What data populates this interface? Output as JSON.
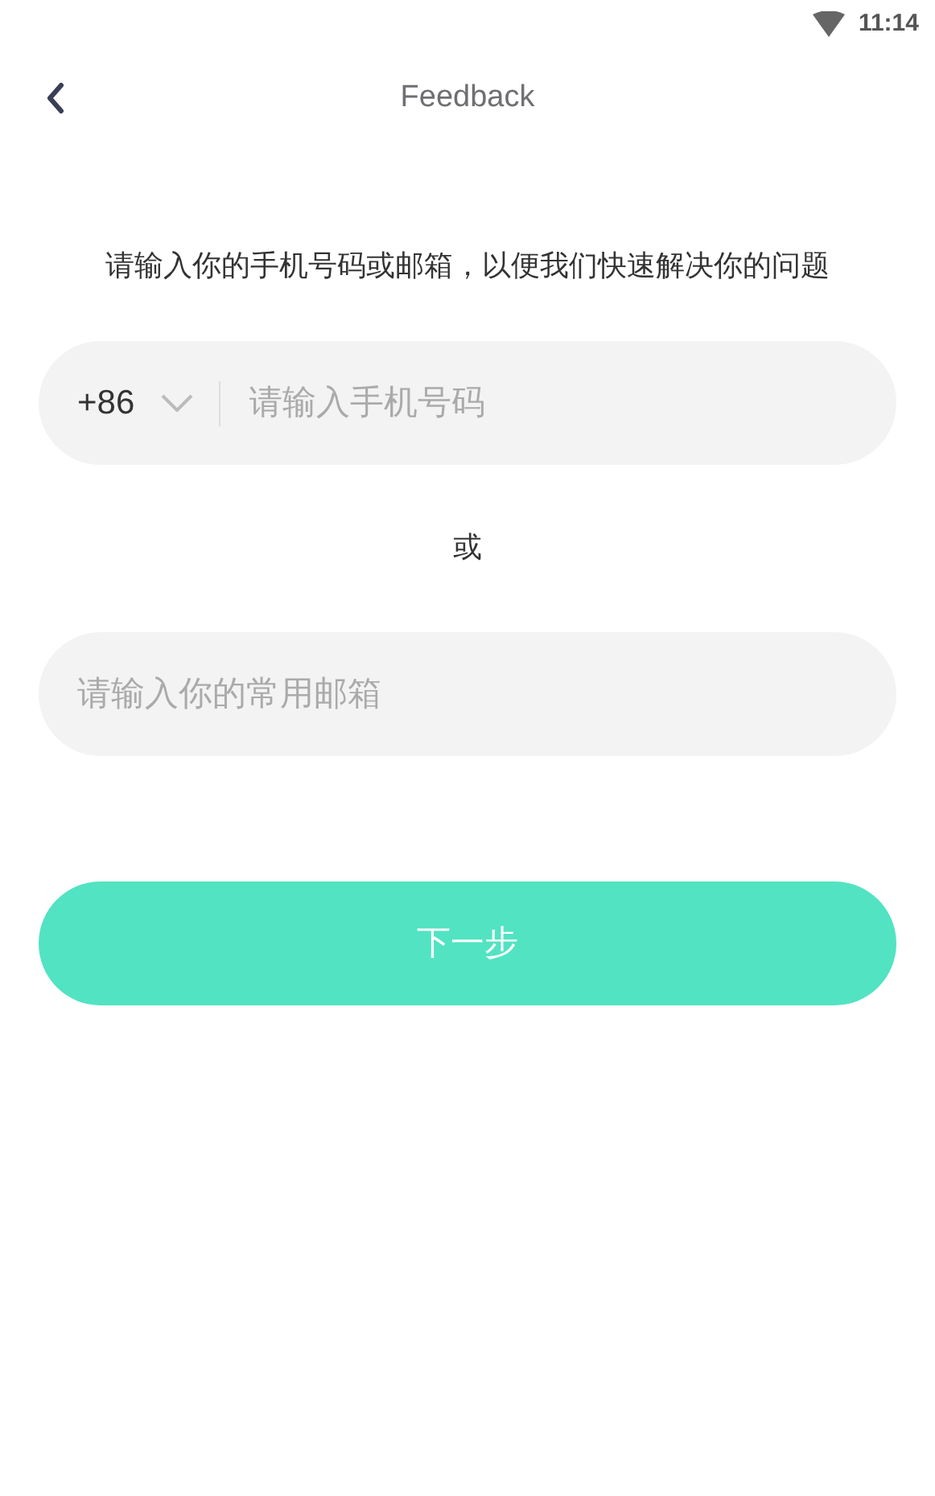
{
  "status_bar": {
    "time": "11:14"
  },
  "header": {
    "title": "Feedback"
  },
  "prompt": "请输入你的手机号码或邮箱，以便我们快速解决你的问题",
  "phone_field": {
    "country_code": "+86",
    "placeholder": "请输入手机号码"
  },
  "separator": "或",
  "email_field": {
    "placeholder": "请输入你的常用邮箱"
  },
  "next_button": {
    "label": "下一步"
  }
}
